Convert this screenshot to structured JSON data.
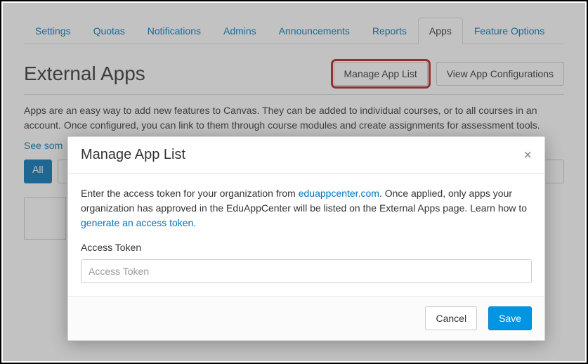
{
  "tabs": {
    "settings": "Settings",
    "quotas": "Quotas",
    "notifications": "Notifications",
    "admins": "Admins",
    "announcements": "Announcements",
    "reports": "Reports",
    "apps": "Apps",
    "feature_options": "Feature Options"
  },
  "header": {
    "title": "External Apps",
    "manage_btn": "Manage App List",
    "view_config_btn": "View App Configurations"
  },
  "description": {
    "text": "Apps are an easy way to add new features to Canvas. They can be added to individual courses, or to all courses in an account. Once configured, you can link to them through course modules and create assignments for assessment tools.",
    "see_some": "See som"
  },
  "filter": {
    "all": "All"
  },
  "modal": {
    "title": "Manage App List",
    "close": "×",
    "body_pre": "Enter the access token for your organization from ",
    "eduapp_link": "eduappcenter.com",
    "body_mid": ". Once applied, only apps your organization has approved in the EduAppCenter will be listed on the External Apps page. Learn how to ",
    "generate_link": "generate an access token",
    "body_post": ".",
    "token_label": "Access Token",
    "token_placeholder": "Access Token",
    "cancel": "Cancel",
    "save": "Save"
  }
}
